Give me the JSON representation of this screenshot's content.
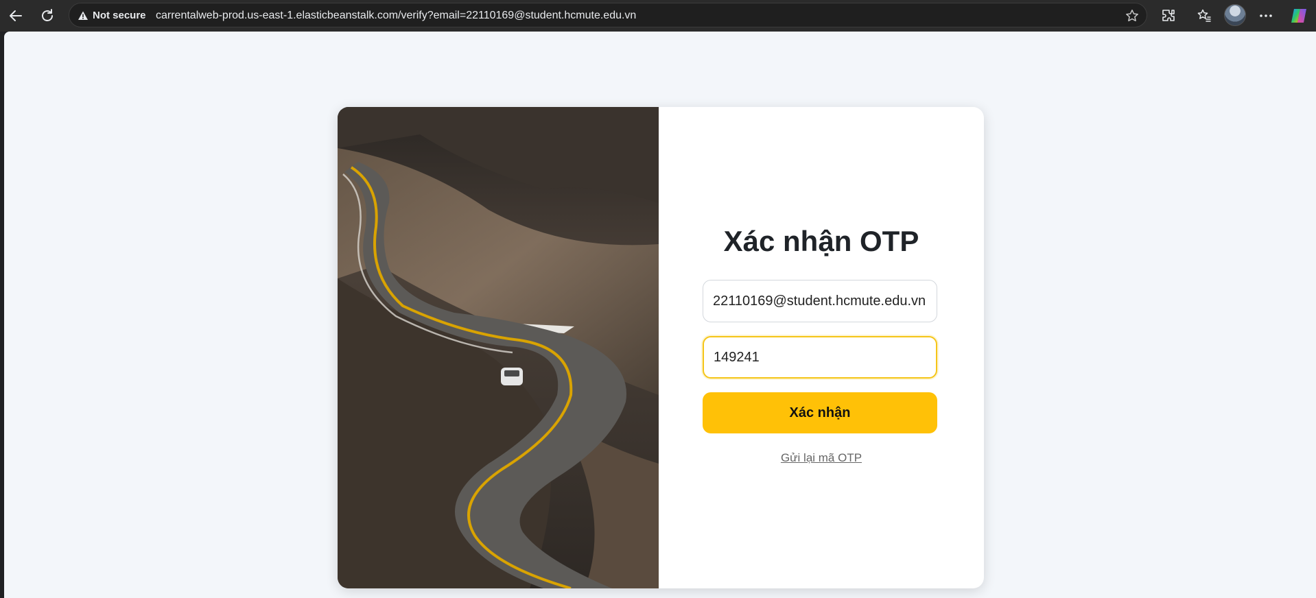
{
  "browser": {
    "security_label": "Not secure",
    "url": "carrentalweb-prod.us-east-1.elasticbeanstalk.com/verify?email=22110169@student.hcmute.edu.vn"
  },
  "page": {
    "title": "Xác nhận OTP",
    "email_value": "22110169@student.hcmute.edu.vn",
    "otp_value": "149241",
    "submit_label": "Xác nhận",
    "resend_label": "Gửi lại mã OTP"
  },
  "colors": {
    "accent": "#ffc107",
    "page_bg": "#f3f6fa",
    "browser_bar": "#2b2b2b"
  },
  "icons": [
    "back-arrow-icon",
    "reload-icon",
    "warning-icon",
    "star-icon",
    "extensions-icon",
    "favorites-icon",
    "more-icon",
    "copilot-icon"
  ]
}
